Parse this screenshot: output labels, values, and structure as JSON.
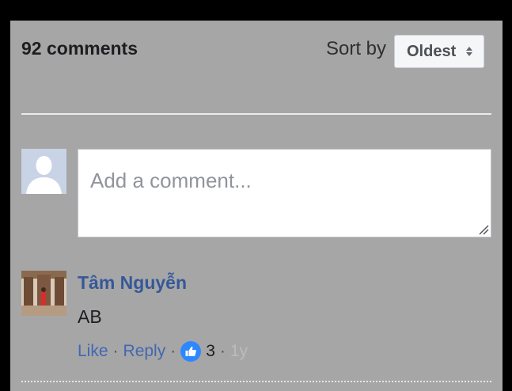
{
  "header": {
    "comment_count": "92 comments",
    "sort_label": "Sort by",
    "sort_value": "Oldest"
  },
  "composer": {
    "placeholder": "Add a comment..."
  },
  "comments": [
    {
      "author": "Tâm Nguyễn",
      "text": "AB",
      "like_label": "Like",
      "reply_label": "Reply",
      "like_count": "3",
      "time": "1y"
    }
  ],
  "colors": {
    "panel_bg": "#a6a6a6",
    "link": "#4267b2",
    "author": "#365899",
    "like_badge": "#2d88ff"
  }
}
